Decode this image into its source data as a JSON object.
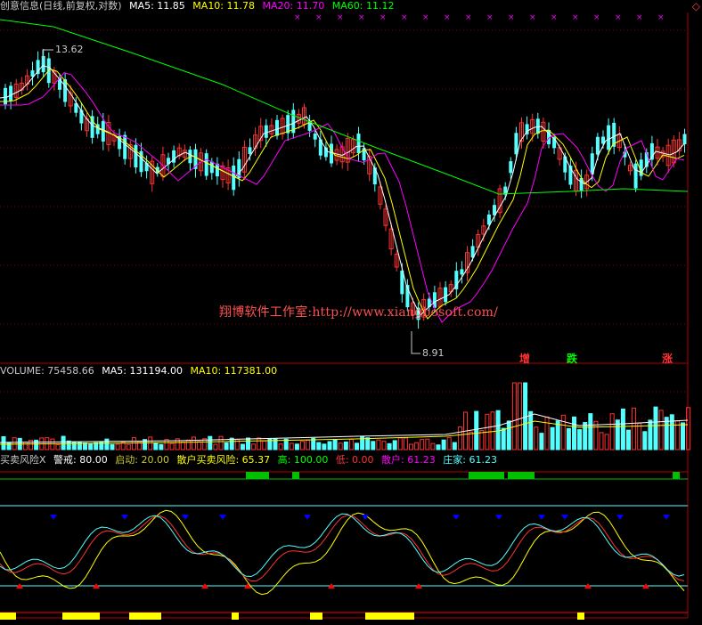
{
  "price_header": {
    "title": "创意信息(日线,前复权,对数)",
    "ma5": "MA5: 11.85",
    "ma10": "MA10: 11.78",
    "ma20": "MA20: 11.70",
    "ma60": "MA60: 11.12"
  },
  "price_chart": {
    "high_label": "13.62",
    "low_label": "8.91",
    "watermark": "翔博软件工作室:http://www.xiangbosoft.com/",
    "event_up": "增",
    "event_fall": "跌",
    "event_rise": "涨",
    "corner_symbol": "◇"
  },
  "volume_header": {
    "volume": "VOLUME: 75458.66",
    "ma5": "MA5: 131194.00",
    "ma10": "MA10: 117381.00"
  },
  "indicator_header": {
    "name": "买卖风险X",
    "warn": "警戒: 80.00",
    "start": "启动: 20.00",
    "retail_risk": "散户买卖风险: 65.37",
    "high": "高: 100.00",
    "low": "低: 0.00",
    "retail": "散户: 61.23",
    "banker": "庄家: 61.23"
  },
  "colors": {
    "up": "#ff3232",
    "down": "#54ffff",
    "ma5": "#ffffff",
    "ma10": "#ffff00",
    "ma20": "#ff00ff",
    "ma60": "#00ff00",
    "grid": "#8b0000"
  }
}
